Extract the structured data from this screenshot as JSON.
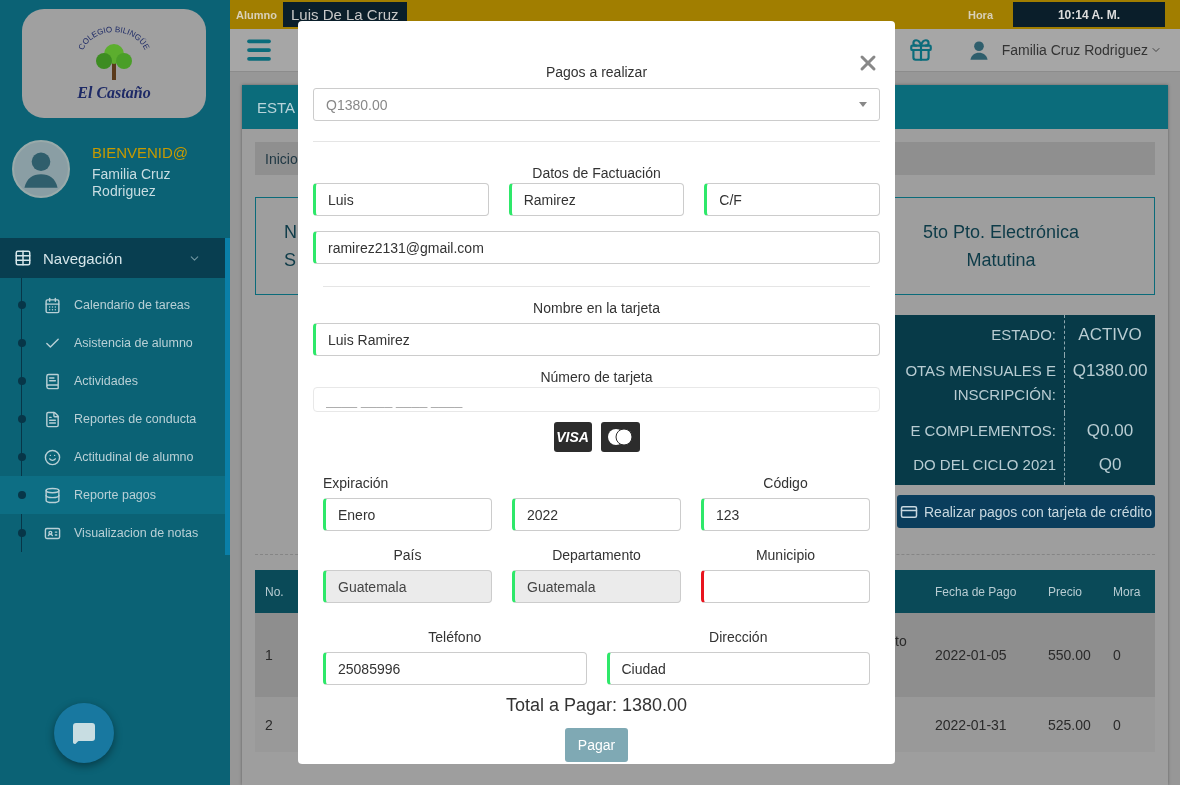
{
  "topbar": {
    "student_label": "Alumno",
    "student_name": "Luis De La Cruz",
    "time_label": "Hora",
    "time": "10:14 A. M."
  },
  "sidebar": {
    "logo_arc": "COLEGIO BILINGÜE",
    "logo_name": "El Castaño",
    "welcome": "BIENVENID@",
    "user": "Familia Cruz Rodriguez",
    "nav_title": "Navegación",
    "items": [
      {
        "label": "Calendario de tareas",
        "selected": false
      },
      {
        "label": "Asistencia de alumno",
        "selected": false
      },
      {
        "label": "Actividades",
        "selected": false
      },
      {
        "label": "Reportes de conducta",
        "selected": false
      },
      {
        "label": "Actitudinal de alumno",
        "selected": false
      },
      {
        "label": "Reporte pagos",
        "selected": true
      },
      {
        "label": "Visualizacion de notas",
        "selected": false
      }
    ]
  },
  "header": {
    "user": "Familia Cruz Rodriguez"
  },
  "card": {
    "title": "ESTA",
    "breadcrumb": "Inicio",
    "info_left": [
      "N",
      "S"
    ],
    "info_right": [
      "5to Pto. Electrónica",
      "Matutina"
    ],
    "summary": [
      {
        "label": "ESTADO:",
        "value": "ACTIVO"
      },
      {
        "label": "OTAS MENSUALES E\nINSCRIPCIÓN:",
        "value": "Q1380.00"
      },
      {
        "label": "E COMPLEMENTOS:",
        "value": "Q0.00"
      },
      {
        "label": "DO DEL CICLO 2021",
        "value": "Q0"
      }
    ],
    "pay_button": "Realizar pagos con tarjeta de crédito",
    "table": {
      "columns": [
        "No.",
        "Fecha de Pago",
        "Precio",
        "Mora"
      ],
      "rows": [
        {
          "no": "1",
          "column_3": "to",
          "date": "2022-01-05",
          "price": "550.00",
          "late": "0"
        },
        {
          "no": "2",
          "date": "2022-01-31",
          "price": "525.00",
          "late": "0"
        }
      ]
    }
  },
  "modal": {
    "payment_label": "Pagos a realizar",
    "payment_value": "Q1380.00",
    "billing_title": "Datos de Factuación",
    "billing_fields": [
      {
        "value": "Luis",
        "valid": true
      },
      {
        "value": "Ramirez",
        "valid": true
      },
      {
        "value": "C/F",
        "valid": true
      }
    ],
    "email": {
      "value": "ramirez2131@gmail.com",
      "valid": true
    },
    "card_name_label": "Nombre en la tarjeta",
    "card_name": {
      "value": "Luis Ramirez",
      "valid": true
    },
    "card_number_label": "Número de tarjeta",
    "card_number": {
      "placeholder": "____ ____ ____ ____"
    },
    "brands": [
      {
        "kind": "visa",
        "text": "VISA"
      },
      {
        "kind": "mastercard"
      }
    ],
    "expiration_label": "Expiración",
    "code_label": "Código",
    "expiration": [
      {
        "value": "Enero",
        "valid": true
      },
      {
        "value": "2022",
        "valid": true
      }
    ],
    "code": {
      "value": "123",
      "valid": true
    },
    "location": [
      {
        "label": "País",
        "value": "Guatemala",
        "valid": true,
        "disabled": true
      },
      {
        "label": "Departamento",
        "value": "Guatemala",
        "valid": true,
        "disabled": true
      },
      {
        "label": "Municipio",
        "valid": false,
        "disabled": false
      }
    ],
    "contact": [
      {
        "label": "Teléfono",
        "value": "25085996",
        "valid": true
      },
      {
        "label": "Dirección",
        "value": "Ciudad",
        "valid": true
      }
    ],
    "total": "Total a Pagar: 1380.00",
    "submit": "Pagar"
  }
}
